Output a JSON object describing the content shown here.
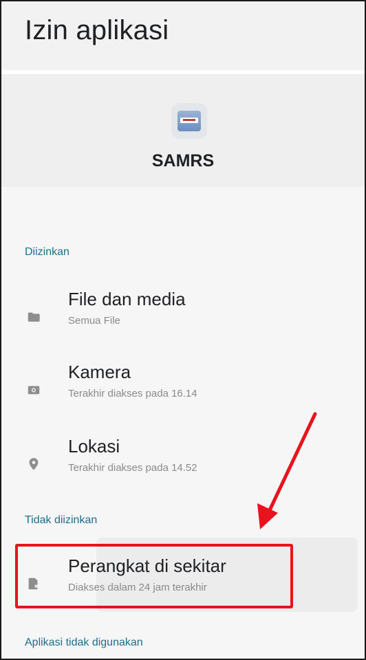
{
  "header": {
    "title": "Izin aplikasi"
  },
  "app": {
    "name": "SAMRS",
    "icon_text": "SAMRS"
  },
  "sections": {
    "allowed": {
      "label": "Diizinkan",
      "items": [
        {
          "title": "File dan media",
          "subtitle": "Semua File",
          "icon": "folder-icon"
        },
        {
          "title": "Kamera",
          "subtitle": "Terakhir diakses pada 16.14",
          "icon": "camera-icon"
        },
        {
          "title": "Lokasi",
          "subtitle": "Terakhir diakses pada 14.52",
          "icon": "location-icon"
        }
      ]
    },
    "not_allowed": {
      "label": "Tidak diizinkan",
      "items": [
        {
          "title": "Perangkat di sekitar",
          "subtitle": "Diakses dalam 24 jam terakhir",
          "icon": "nearby-devices-icon"
        }
      ]
    },
    "unused": {
      "label": "Aplikasi tidak digunakan"
    }
  },
  "annotation": {
    "color": "#e8131d"
  },
  "colors": {
    "accent": "#1a6e8a",
    "icon_gray": "#8e8e8e"
  }
}
